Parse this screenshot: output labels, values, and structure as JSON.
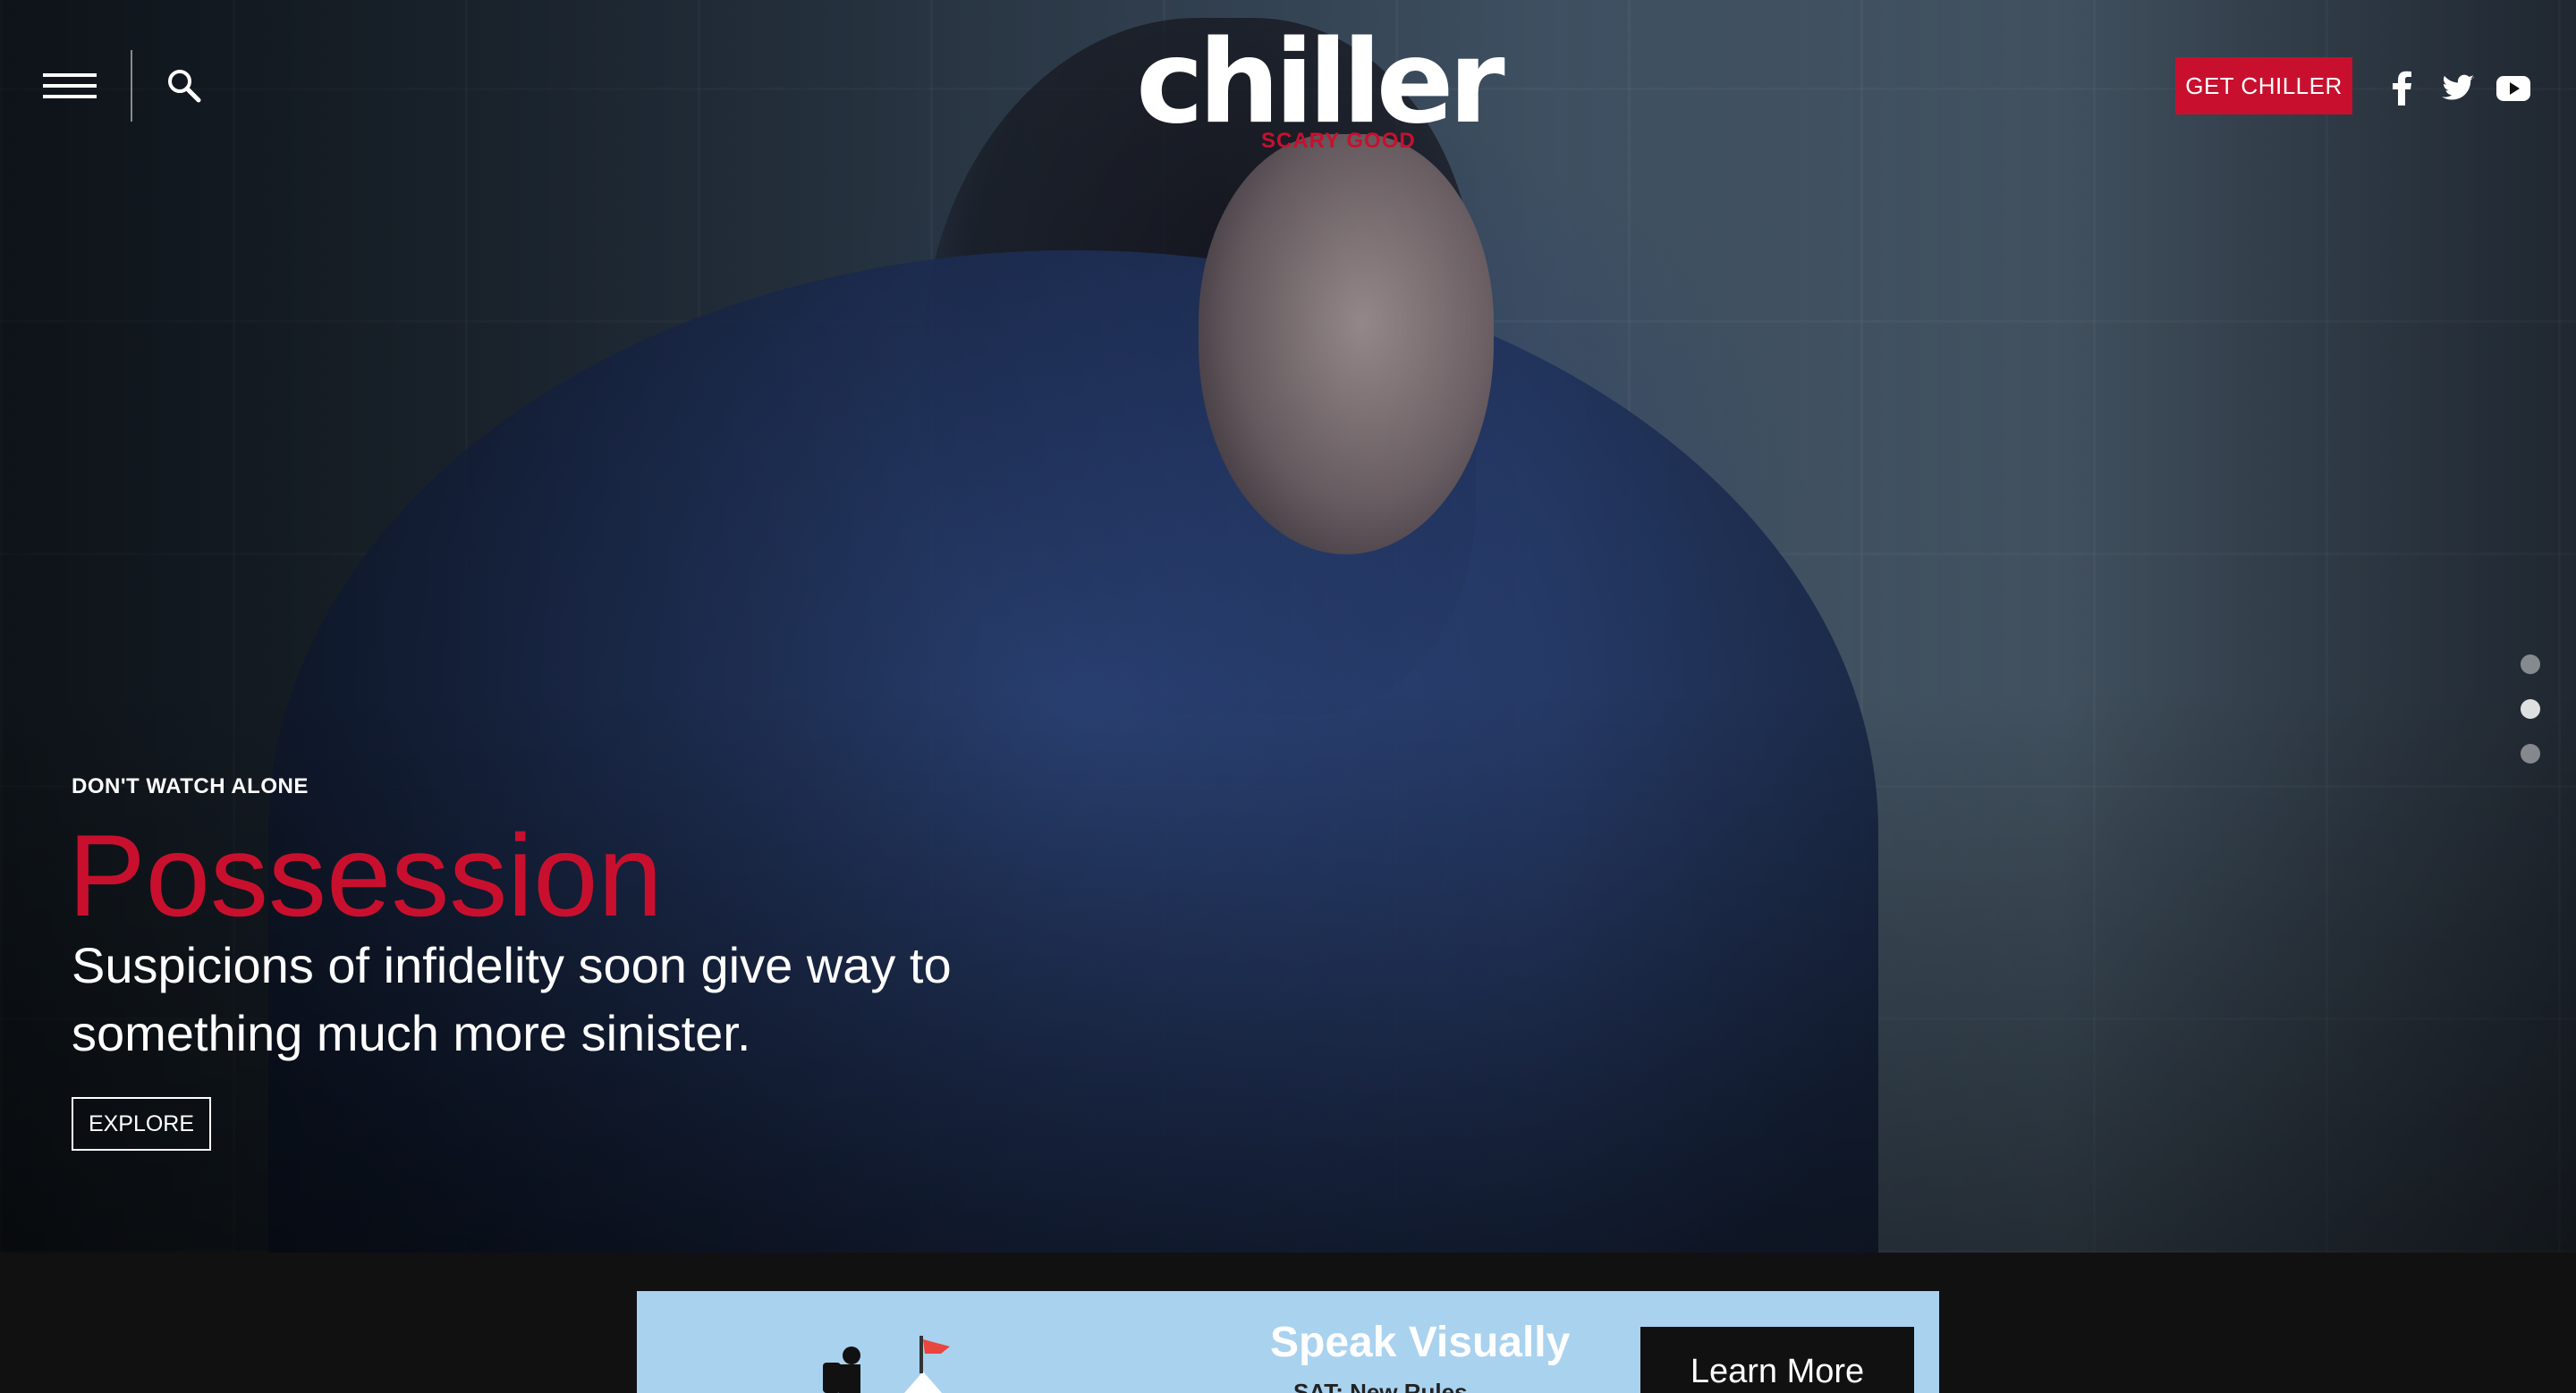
{
  "header": {
    "logo_word": "chiller",
    "logo_tagline": "SCARY GOOD",
    "cta_label": "GET CHILLER",
    "social_icons": [
      "facebook-icon",
      "twitter-icon",
      "youtube-icon"
    ]
  },
  "hero": {
    "eyebrow": "DON'T WATCH ALONE",
    "title": "Possession",
    "description": "Suspicions of infidelity soon give way to something much more sinister.",
    "button_label": "EXPLORE",
    "slides_total": 3,
    "active_slide": 2
  },
  "ad": {
    "headline": "Speak Visually",
    "subline": "SAT: New Rules",
    "cta": "Learn More"
  },
  "colors": {
    "brand_red": "#c8102e",
    "ad_background": "#a9d2ef"
  }
}
